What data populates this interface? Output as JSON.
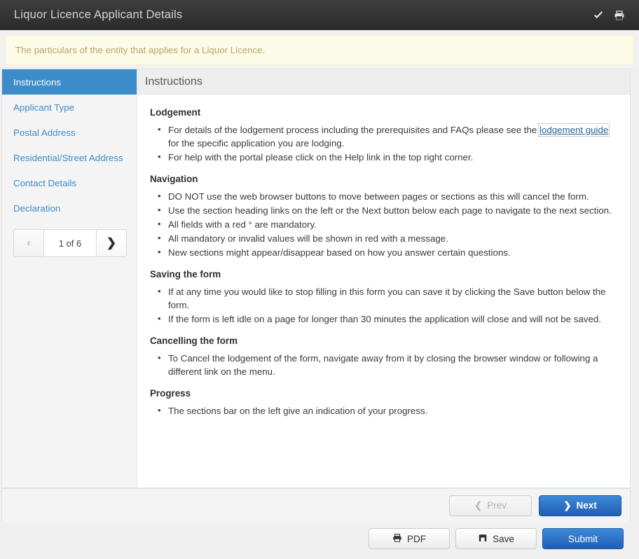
{
  "header": {
    "title": "Liquor Licence Applicant Details",
    "icons": [
      {
        "name": "check-icon",
        "glyph": "✔"
      },
      {
        "name": "print-icon",
        "glyph": "⎙"
      }
    ]
  },
  "notice": {
    "text": "The particulars of the entity that applies for a Liquor Licence."
  },
  "sidebar": {
    "items": [
      {
        "label": "Instructions",
        "active": true
      },
      {
        "label": "Applicant Type",
        "active": false
      },
      {
        "label": "Postal Address",
        "active": false
      },
      {
        "label": "Residential/Street Address",
        "active": false
      },
      {
        "label": "Contact Details",
        "active": false
      },
      {
        "label": "Declaration",
        "active": false
      }
    ],
    "pager": {
      "prev_glyph": "‹",
      "next_glyph": "❯",
      "label": "1 of 6"
    }
  },
  "content": {
    "heading": "Instructions",
    "sections": [
      {
        "title": "Lodgement",
        "items": [
          {
            "before": "For details of the lodgement process including the prerequisites and FAQs please see the ",
            "link": "lodgement guide",
            "after": " for the specific application you are lodging."
          },
          {
            "before": "For help with the portal please click on the Help link in the top right corner."
          }
        ]
      },
      {
        "title": "Navigation",
        "items": [
          {
            "before": "DO NOT use the web browser buttons to move between pages or sections as this will cancel the form."
          },
          {
            "before": "Use the section heading links on the left or the Next button below each page to navigate to the next section."
          },
          {
            "before": "All fields with a red ",
            "star": "*",
            "after": " are mandatory."
          },
          {
            "before": "All mandatory or invalid values will be shown in red with a message."
          },
          {
            "before": "New sections might appear/disappear based on how you answer certain questions."
          }
        ]
      },
      {
        "title": "Saving the form",
        "items": [
          {
            "before": "If at any time you would like to stop filling in this form you can save it by clicking the Save button below the form."
          },
          {
            "before": "If the form is left idle on a page for longer than 30 minutes the application will close and will not be saved."
          }
        ]
      },
      {
        "title": "Cancelling the form",
        "items": [
          {
            "before": "To Cancel the lodgement of the form, navigate away from it by closing the browser window or following a different link on the menu."
          }
        ]
      },
      {
        "title": "Progress",
        "items": [
          {
            "before": "The sections bar on the left give an indication of your progress."
          }
        ]
      }
    ]
  },
  "panel_footer": {
    "prev_label": "Prev",
    "prev_glyph": "❮",
    "next_label": "Next",
    "next_glyph": "❯"
  },
  "action_bar": {
    "pdf_label": "PDF",
    "pdf_icon": "print-icon",
    "save_label": "Save",
    "save_icon": "save-icon",
    "submit_label": "Submit"
  },
  "colors": {
    "header_bg": "#343434",
    "notice_bg": "#fcfbe8",
    "notice_text": "#bda36a",
    "accent_blue": "#3b8cc8",
    "link_blue": "#2a6496",
    "primary_button": "#2f74c6",
    "required_red": "#e23b3b"
  }
}
